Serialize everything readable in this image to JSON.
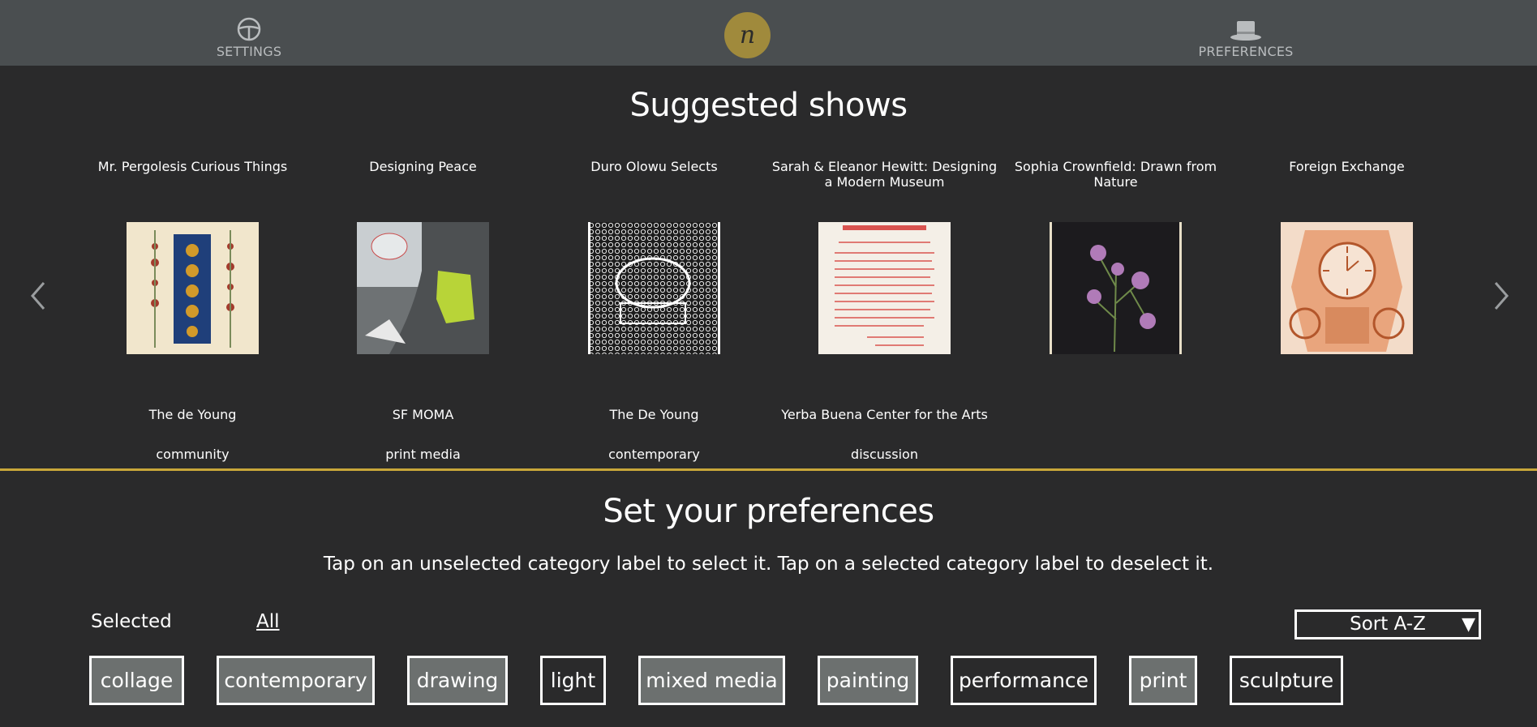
{
  "nav": {
    "settings_label": "SETTINGS",
    "preferences_label": "PREFERENCES",
    "logo_letter": "n"
  },
  "suggested": {
    "heading": "Suggested shows",
    "shows": [
      {
        "title": "Mr. Pergolesis Curious Things",
        "venue": "The de Young",
        "category": "community"
      },
      {
        "title": "Designing Peace",
        "venue": "SF MOMA",
        "category": "print media"
      },
      {
        "title": "Duro Olowu Selects",
        "venue": "The De Young",
        "category": "contemporary"
      },
      {
        "title": "Sarah & Eleanor Hewitt: Designing a Modern Museum",
        "venue": "Yerba Buena Center for the Arts",
        "category": "discussion"
      },
      {
        "title": "Sophia Crownfield: Drawn from Nature",
        "venue": "",
        "category": ""
      },
      {
        "title": "Foreign Exchange",
        "venue": "",
        "category": ""
      }
    ]
  },
  "preferences": {
    "heading": "Set your preferences",
    "instructions": "Tap on an unselected category label to select it. Tap on a selected category label to deselect it.",
    "tab_selected": "Selected",
    "tab_all": "All",
    "sort_label": "Sort A-Z",
    "sort_caret": "▼",
    "categories": [
      {
        "label": "collage",
        "selected": true
      },
      {
        "label": "contemporary",
        "selected": true
      },
      {
        "label": "drawing",
        "selected": true
      },
      {
        "label": "light",
        "selected": false
      },
      {
        "label": "mixed media",
        "selected": true
      },
      {
        "label": "painting",
        "selected": true
      },
      {
        "label": "performance",
        "selected": false
      },
      {
        "label": "print",
        "selected": true
      },
      {
        "label": "sculpture",
        "selected": false
      }
    ]
  },
  "colors": {
    "topbar": "#4a4e50",
    "background": "#2a2a2b",
    "accent": "#c9a73a",
    "logo": "#a08a3c",
    "chip_selected": "#6c706f"
  }
}
